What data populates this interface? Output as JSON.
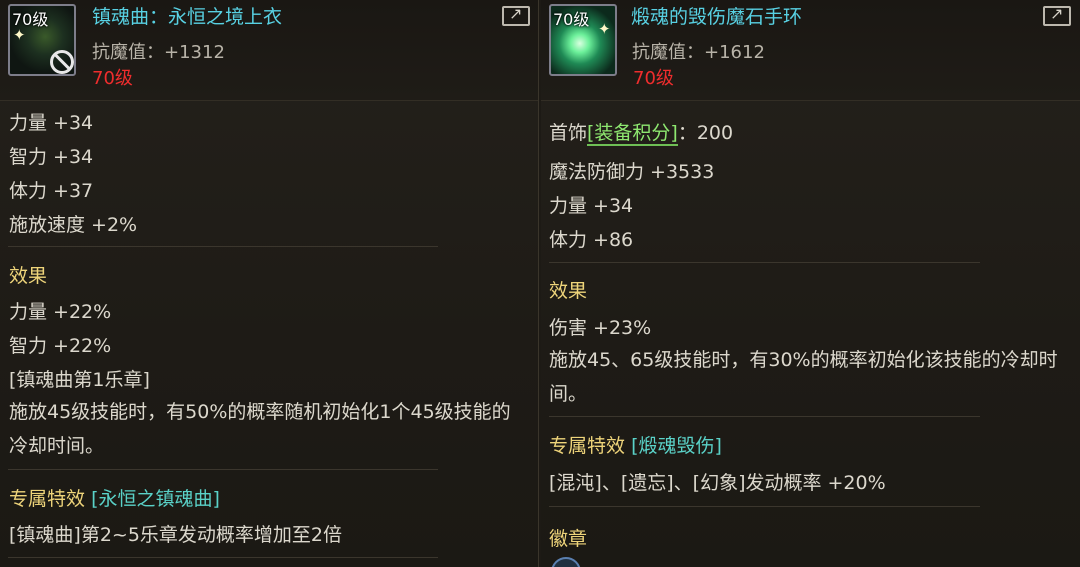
{
  "left": {
    "level_badge": "70级",
    "title": "镇魂曲：永恒之境上衣",
    "resistance": "抗魔值：+1312",
    "level": "70级",
    "stats": [
      "力量 +34",
      "智力 +34",
      "体力 +37",
      "施放速度 +2%"
    ],
    "effect_heading": "效果",
    "effects": [
      "力量 +22%",
      "智力 +22%",
      "[镇魂曲第1乐章]",
      "施放45级技能时，有50%的概率随机初始化1个45级技能的冷却时间。"
    ],
    "special_heading": "专属特效",
    "special_name": "[永恒之镇魂曲]",
    "special_desc": "[镇魂曲]第2~5乐章发动概率增加至2倍"
  },
  "right": {
    "level_badge": "70级",
    "title": "煅魂的毁伤魔石手环",
    "resistance": "抗魔值：+1612",
    "level": "70级",
    "score_prefix": "首饰",
    "score_tag": "[装备积分]",
    "score_value": "：200",
    "stats": [
      "魔法防御力 +3533",
      "力量 +34",
      "体力 +86"
    ],
    "effect_heading": "效果",
    "effects": [
      "伤害 +23%",
      "施放45、65级技能时，有30%的概率初始化该技能的冷却时间。"
    ],
    "special_heading": "专属特效",
    "special_name": "[煅魂毁伤]",
    "special_desc": "[混沌]、[遗忘]、[幻象]发动概率 +20%",
    "badge_heading": "徽章"
  },
  "colors": {
    "title": "#58d1e3",
    "level_red": "#ef2d2d",
    "heading_gold": "#eed47a",
    "tag_green": "#8ee870",
    "special_cyan": "#5ad2c8"
  },
  "icons": {
    "left_item": "armor-top-icon",
    "right_item": "bracelet-icon",
    "compare": "compare-icon",
    "unusable": "prohibit-icon"
  }
}
